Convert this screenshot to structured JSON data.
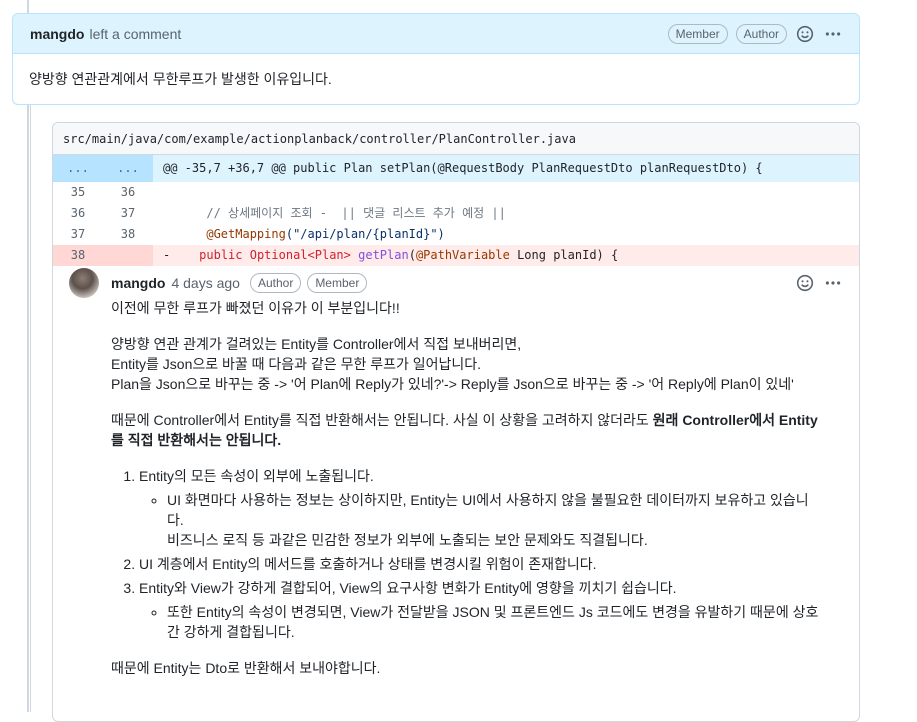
{
  "top_comment": {
    "author": "mangdo",
    "action": "left a comment",
    "badges": [
      "Member",
      "Author"
    ],
    "body": "양방향 연관관계에서 무한루프가 발생한 이유입니다."
  },
  "review": {
    "file_path": "src/main/java/com/example/actionplanback/controller/PlanController.java",
    "hunk": {
      "old_num": "...",
      "new_num": "...",
      "text": "@@ -35,7 +36,7 @@ public Plan setPlan(@RequestBody PlanRequestDto planRequestDto) {"
    },
    "lines": [
      {
        "old": "35",
        "new": "36",
        "prefix": " ",
        "text": ""
      },
      {
        "old": "36",
        "new": "37",
        "prefix": " ",
        "text": "// 상세페이지 조회 -  || 댓글 리스트 추가 예정 ||"
      },
      {
        "old": "37",
        "new": "38",
        "prefix": " ",
        "anno": "@GetMapping",
        "args": "(\"/api/plan/{planId}\")"
      },
      {
        "old": "38",
        "new": "",
        "prefix": "-",
        "kw": "public",
        "type1": "Optional<Plan>",
        "fn": "getPlan",
        "open": "(",
        "anno": "@PathVariable",
        "rest": " Long planId) {"
      }
    ]
  },
  "reply": {
    "author": "mangdo",
    "time": "4 days ago",
    "badges": [
      "Author",
      "Member"
    ],
    "p1": "이전에 무한 루프가 빠졌던 이유가 이 부분입니다!!",
    "p2_lines": [
      "양방향 연관 관계가 걸려있는 Entity를 Controller에서 직접 보내버리면,",
      "Entity를 Json으로 바꿀 때 다음과 같은 무한 루프가 일어납니다.",
      "Plan을 Json으로 바꾸는 중 -> '어 Plan에 Reply가 있네?'-> Reply를 Json으로 바꾸는 중 -> '어 Reply에 Plan이 있네'"
    ],
    "p3_normal": "때문에 Controller에서 Entity를 직접 반환해서는 안됩니다. 사실 이 상황을 고려하지 않더라도 ",
    "p3_bold": "원래 Controller에서 Entity를 직접 반환해서는 안됩니다.",
    "list": [
      {
        "text": "Entity의 모든 속성이 외부에 노출됩니다.",
        "sub": [
          "UI 화면마다 사용하는 정보는 상이하지만, Entity는 UI에서 사용하지 않을 불필요한 데이터까지 보유하고 있습니다.",
          "비즈니스 로직 등 과같은 민감한 정보가 외부에 노출되는 보안 문제와도 직결됩니다."
        ]
      },
      {
        "text": "UI 계층에서 Entity의 메서드를 호출하거나 상태를 변경시킬 위험이 존재합니다.",
        "sub": []
      },
      {
        "text": "Entity와 View가 강하게 결합되어, View의 요구사항 변화가 Entity에 영향을 끼치기 쉽습니다.",
        "sub": [
          "또한 Entity의 속성이 변경되면, View가 전달받을 JSON 및 프론트엔드 Js 코드에도 변경을 유발하기 때문에 상호간 강하게 결합됩니다."
        ]
      }
    ],
    "p4": "때문에 Entity는 Dto로 반환해서 보내야합니다."
  }
}
